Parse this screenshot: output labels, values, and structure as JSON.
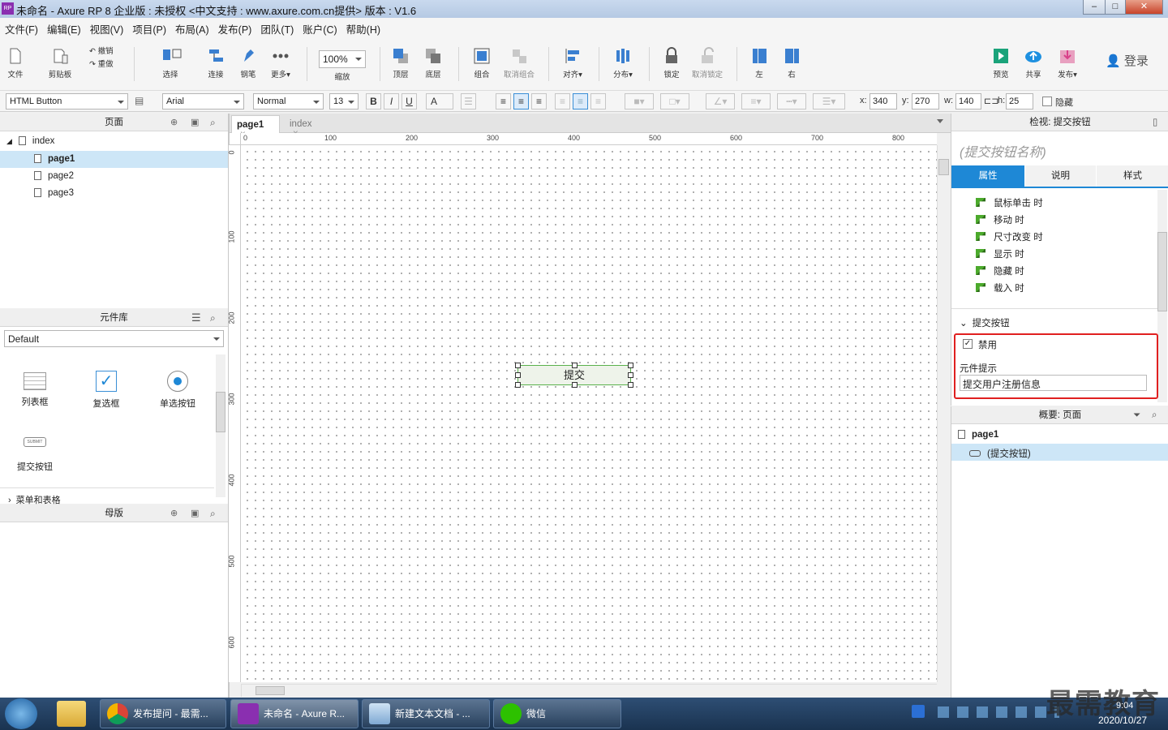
{
  "window": {
    "title": "未命名 - Axure RP 8 企业版 : 未授权      <中文支持 : www.axure.com.cn提供> 版本 : V1.6",
    "app_icon": "RP",
    "minimize": "–",
    "maximize": "□",
    "close": "✕"
  },
  "menu": [
    "文件(F)",
    "编辑(E)",
    "视图(V)",
    "项目(P)",
    "布局(A)",
    "发布(P)",
    "团队(T)",
    "账户(C)",
    "帮助(H)"
  ],
  "toolbar": {
    "file": "文件",
    "clipboard": "剪贴板",
    "undo": "撤销",
    "redo": "重做",
    "select": "选择",
    "connect": "连接",
    "pen": "钢笔",
    "more": "更多▾",
    "zoom_value": "100%",
    "zoom": "缩放",
    "top": "顶层",
    "bottom": "底层",
    "group": "组合",
    "ungroup": "取消组合",
    "align": "对齐▾",
    "distribute": "分布▾",
    "lock": "锁定",
    "unlock": "取消锁定",
    "left": "左",
    "right": "右",
    "preview": "预览",
    "share": "共享",
    "publish": "发布▾",
    "login": "登录",
    "preview_color": "#1aa37a",
    "share_color": "#1e90e0",
    "publish_color": "#d9408a"
  },
  "format": {
    "widget_type": "HTML Button",
    "font": "Arial",
    "weight": "Normal",
    "size": "13",
    "bold": "B",
    "italic": "I",
    "underline": "U",
    "font_color": "A",
    "x_label": "x:",
    "x": "340",
    "y_label": "y:",
    "y": "270",
    "w_label": "w:",
    "w": "140",
    "h_label": "h:",
    "h": "25",
    "hidden": "隐藏"
  },
  "pages_panel": {
    "title": "页面",
    "root": "index",
    "pages": [
      "page1",
      "page2",
      "page3"
    ],
    "selected": "page1"
  },
  "library_panel": {
    "title": "元件库",
    "library": "Default",
    "items": [
      "列表框",
      "复选框",
      "单选按钮",
      "提交按钮"
    ],
    "submit_icon_text": "SUBMIT",
    "section": "菜单和表格"
  },
  "masters_panel": {
    "title": "母版"
  },
  "tabs": [
    {
      "label": "page1",
      "close": "×"
    },
    {
      "label": "index",
      "close": "×"
    }
  ],
  "ruler": {
    "h": [
      "0",
      "100",
      "200",
      "300",
      "400",
      "500",
      "600",
      "700",
      "800"
    ],
    "v": [
      "0",
      "100",
      "200",
      "300",
      "400",
      "500",
      "600"
    ]
  },
  "canvas": {
    "button_text": "提交"
  },
  "inspector": {
    "title": "检视: 提交按钮",
    "name_placeholder": "(提交按钮名称)",
    "tabs": [
      "属性",
      "说明",
      "样式"
    ],
    "active_tab": "属性",
    "accent_color": "#1e88d6",
    "events": [
      "鼠标单击 时",
      "移动 时",
      "尺寸改变 时",
      "显示 时",
      "隐藏 时",
      "载入 时"
    ],
    "section": "提交按钮",
    "disabled_label": "禁用",
    "disabled_checked": true,
    "tooltip_label": "元件提示",
    "tooltip_value": "提交用户注册信息",
    "highlight_color": "#e02020"
  },
  "outline": {
    "title": "概要: 页面",
    "page": "page1",
    "item": "(提交按钮)"
  },
  "taskbar": {
    "items": [
      "发布提问 - 最需...",
      "未命名 - Axure R...",
      "新建文本文档 - ...",
      "微信"
    ],
    "time": "9:04",
    "date": "2020/10/27",
    "watermark": "最需教育"
  }
}
